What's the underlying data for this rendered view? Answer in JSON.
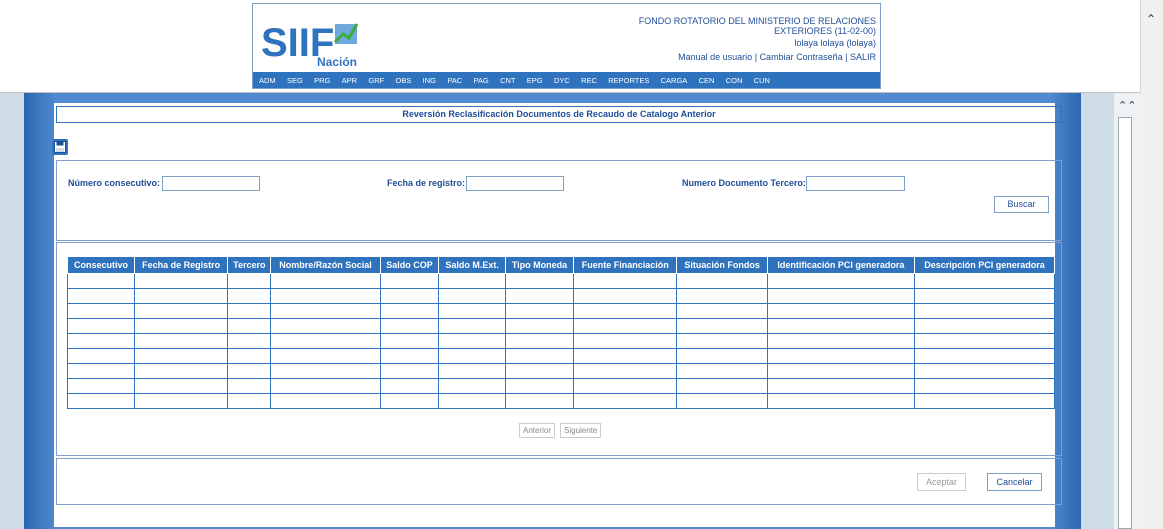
{
  "header": {
    "logo_main": "SIIF",
    "logo_sub": "Nación",
    "entity_line1": "FONDO ROTATORIO DEL MINISTERIO DE RELACIONES",
    "entity_line2": "EXTERIORES (11-02-00)",
    "user": "lolaya lolaya (lolaya)",
    "link_manual": "Manual de usuario",
    "link_change_pw": "Cambiar Contraseña",
    "link_exit": "SALIR",
    "separator": "|"
  },
  "menu": [
    "ADM",
    "SEG",
    "PRG",
    "APR",
    "GRF",
    "OBS",
    "ING",
    "PAC",
    "PAG",
    "CNT",
    "EPG",
    "DYC",
    "REC",
    "REPORTES",
    "CARGA",
    "CEN",
    "CON",
    "CUN"
  ],
  "page": {
    "title": "Reversión Reclasificación Documentos de Recaudo de Catalogo Anterior"
  },
  "search": {
    "consecutivo_label": "Número consecutivo:",
    "consecutivo_value": "",
    "fecha_label": "Fecha de registro:",
    "fecha_value": "",
    "tercero_label": "Numero Documento Tercero:",
    "tercero_value": "",
    "buscar_label": "Buscar"
  },
  "table": {
    "columns": [
      "Consecutivo",
      "Fecha de Registro",
      "Tercero",
      "Nombre/Razón Social",
      "Saldo COP",
      "Saldo M.Ext.",
      "Tipo Moneda",
      "Fuente Financiación",
      "Situación Fondos",
      "Identificación PCI generadora",
      "Descripción PCI generadora"
    ],
    "empty_rows": 9
  },
  "pager": {
    "prev_label": "Anterior",
    "next_label": "Siguiente"
  },
  "actions": {
    "accept_label": "Aceptar",
    "cancel_label": "Cancelar"
  },
  "colors": {
    "primary": "#2f73bf",
    "text_blue": "#1f4d97",
    "frame": "#4f8ad0"
  }
}
